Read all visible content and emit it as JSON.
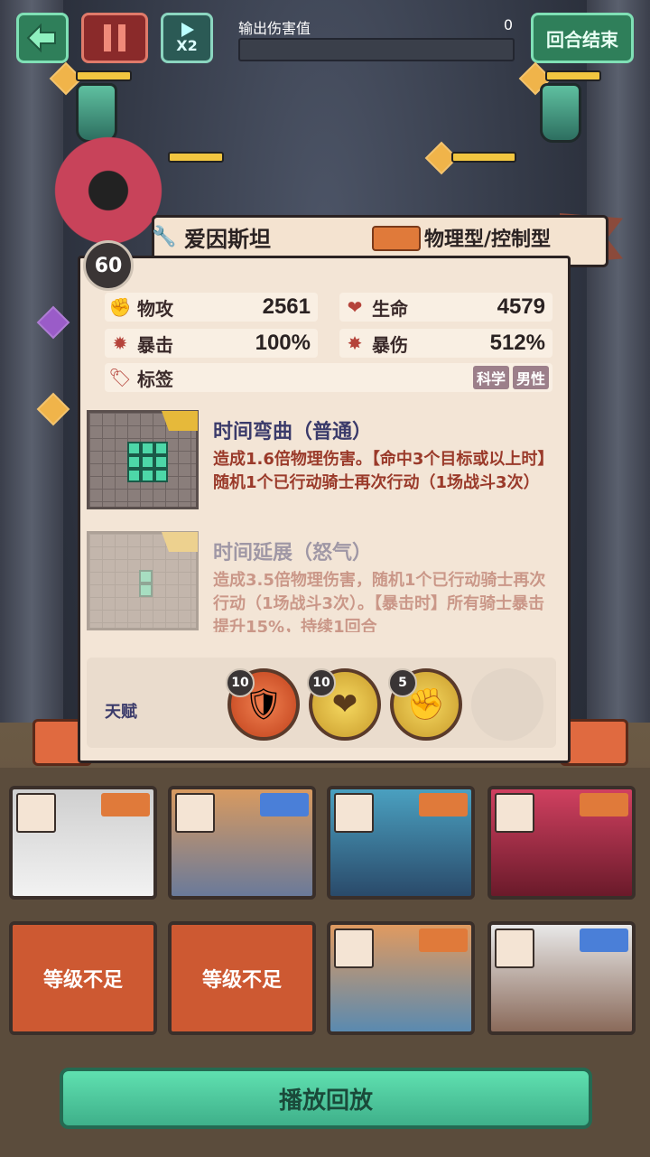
{
  "top_bar": {
    "back_icon": "back-arrow-icon",
    "pause_icon": "pause-icon",
    "speed_label": "X2",
    "damage_label": "输出伤害值",
    "damage_value": "0",
    "end_turn_label": "回合结束"
  },
  "character": {
    "name": "爱因斯坦",
    "level": "60",
    "type": "物理型/控制型",
    "stats": [
      {
        "name": "物攻",
        "value": "2561",
        "icon": "fist-icon"
      },
      {
        "name": "生命",
        "value": "4579",
        "icon": "heart-icon"
      },
      {
        "name": "暴击",
        "value": "100%",
        "icon": "crit-icon"
      },
      {
        "name": "暴伤",
        "value": "512%",
        "icon": "crit-damage-icon"
      }
    ],
    "tags_label": "标签",
    "tags": [
      "科学",
      "男性"
    ]
  },
  "skills": [
    {
      "title": "时间弯曲（普通）",
      "description": "造成1.6倍物理伤害。【命中3个目标或以上时】随机1个已行动骑士再次行动（1场战斗3次）"
    },
    {
      "title": "时间延展（怒气）",
      "description": "造成3.5倍物理伤害，随机1个已行动骑士再次行动（1场战斗3次）。【暴击时】所有骑士暴击提升15%，持续1回合"
    }
  ],
  "talent": {
    "label": "天赋",
    "items": [
      {
        "level": "10",
        "icon": "shield-icon"
      },
      {
        "level": "10",
        "icon": "heart-icon"
      },
      {
        "level": "5",
        "icon": "fist-up-icon"
      }
    ]
  },
  "heroes": [
    {
      "status": "",
      "role_color": "#e07a3a"
    },
    {
      "status": "",
      "role_color": "#4a7fd8"
    },
    {
      "status": "",
      "role_color": "#e07a3a"
    },
    {
      "status": "",
      "role_color": "#e07a3a"
    },
    {
      "status": "等级不足",
      "role_color": "#e07a3a"
    },
    {
      "status": "等级不足",
      "role_color": "#9a5cc8"
    },
    {
      "status": "",
      "role_color": "#e07a3a"
    },
    {
      "status": "",
      "role_color": "#4a7fd8"
    }
  ],
  "replay_label": "播放回放"
}
